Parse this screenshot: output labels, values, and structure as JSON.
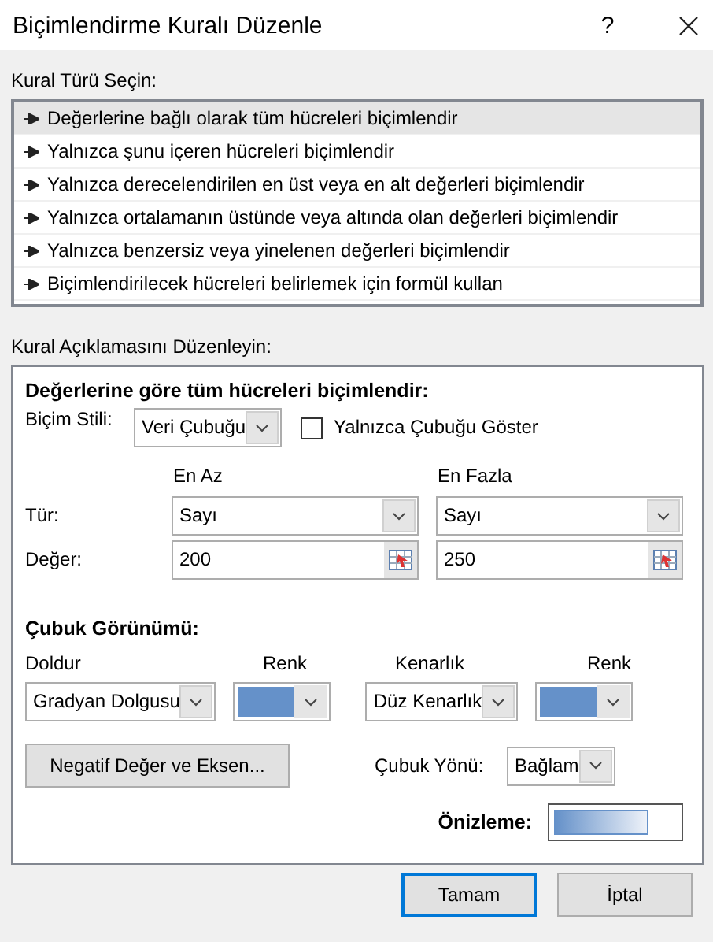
{
  "window": {
    "title": "Biçimlendirme Kuralı Düzenle",
    "help_button": "?"
  },
  "rule_type": {
    "label": "Kural Türü Seçin:",
    "items": [
      {
        "label": "Değerlerine bağlı olarak tüm hücreleri biçimlendir",
        "selected": true
      },
      {
        "label": "Yalnızca şunu içeren hücreleri biçimlendir",
        "selected": false
      },
      {
        "label": "Yalnızca derecelendirilen en üst veya en alt değerleri biçimlendir",
        "selected": false
      },
      {
        "label": "Yalnızca ortalamanın üstünde veya altında olan değerleri biçimlendir",
        "selected": false
      },
      {
        "label": "Yalnızca benzersiz veya yinelenen değerleri biçimlendir",
        "selected": false
      },
      {
        "label": "Biçimlendirilecek hücreleri belirlemek için formül kullan",
        "selected": false
      }
    ]
  },
  "description": {
    "label": "Kural Açıklamasını Düzenleyin:",
    "heading": "Değerlerine göre tüm hücreleri biçimlendir:",
    "format_style": {
      "label": "Biçim Stili:",
      "value": "Veri Çubuğu"
    },
    "show_bar_only": {
      "label": "Yalnızca Çubuğu Göster",
      "checked": false
    },
    "type_label": "Tür:",
    "value_label": "Değer:",
    "minimum": {
      "heading": "En Az",
      "type": "Sayı",
      "value": "200"
    },
    "maximum": {
      "heading": "En Fazla",
      "type": "Sayı",
      "value": "250"
    },
    "bar_appearance": {
      "heading": "Çubuk Görünümü:",
      "fill": {
        "label": "Doldur",
        "value": "Gradyan Dolgusu"
      },
      "fill_color": {
        "label": "Renk",
        "color": "#6591c9"
      },
      "border": {
        "label": "Kenarlık",
        "value": "Düz Kenarlık"
      },
      "border_color": {
        "label": "Renk",
        "color": "#6591c9"
      },
      "negative_button": "Negatif Değer ve Eksen...",
      "direction": {
        "label": "Çubuk Yönü:",
        "value": "Bağlam"
      },
      "preview_label": "Önizleme:"
    }
  },
  "buttons": [
    {
      "label": "Tamam",
      "default": true
    },
    {
      "label": "İptal",
      "default": false
    }
  ]
}
